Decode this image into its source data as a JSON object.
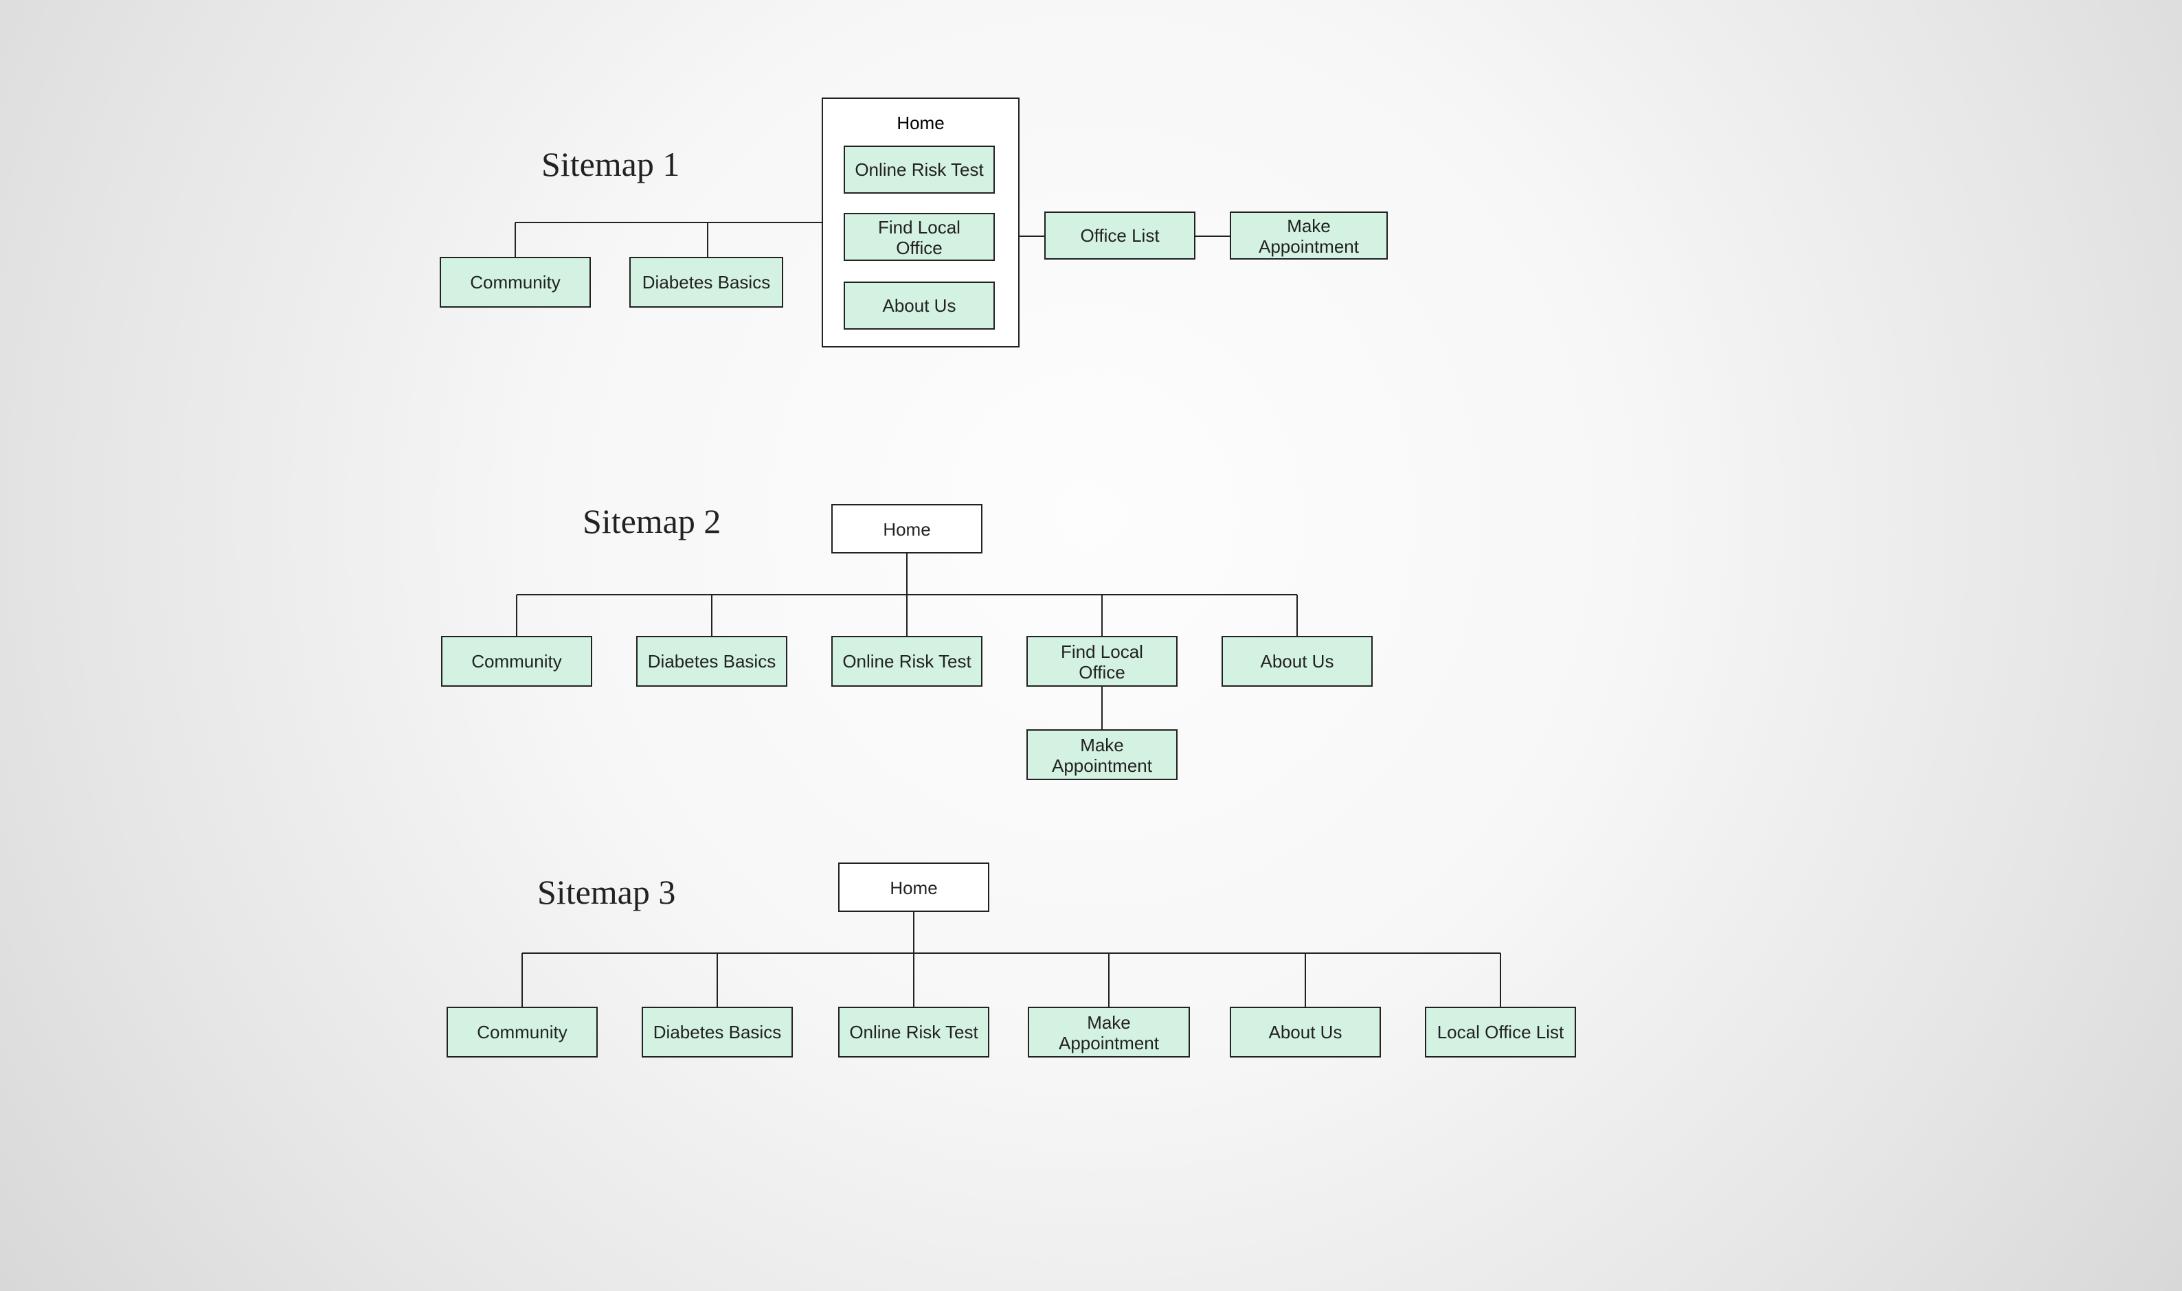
{
  "diagram": {
    "titles": {
      "s1": "Sitemap 1",
      "s2": "Sitemap 2",
      "s3": "Sitemap 3"
    },
    "sitemap1": {
      "home": "Home",
      "inner": {
        "risk": "Online Risk Test",
        "find": "Find Local Office",
        "about": "About Us"
      },
      "left": {
        "community": "Community",
        "basics": "Diabetes Basics"
      },
      "right": {
        "office_list": "Office List",
        "make_appt": "Make Appointment"
      }
    },
    "sitemap2": {
      "home": "Home",
      "children": {
        "community": "Community",
        "basics": "Diabetes Basics",
        "risk": "Online Risk Test",
        "find": "Find Local Office",
        "about": "About Us"
      },
      "appt": "Make Appointment"
    },
    "sitemap3": {
      "home": "Home",
      "children": {
        "community": "Community",
        "basics": "Diabetes Basics",
        "risk": "Online Risk Test",
        "make_appt": "Make Appointment",
        "about": "About Us",
        "office_list": "Local Office List"
      }
    }
  }
}
